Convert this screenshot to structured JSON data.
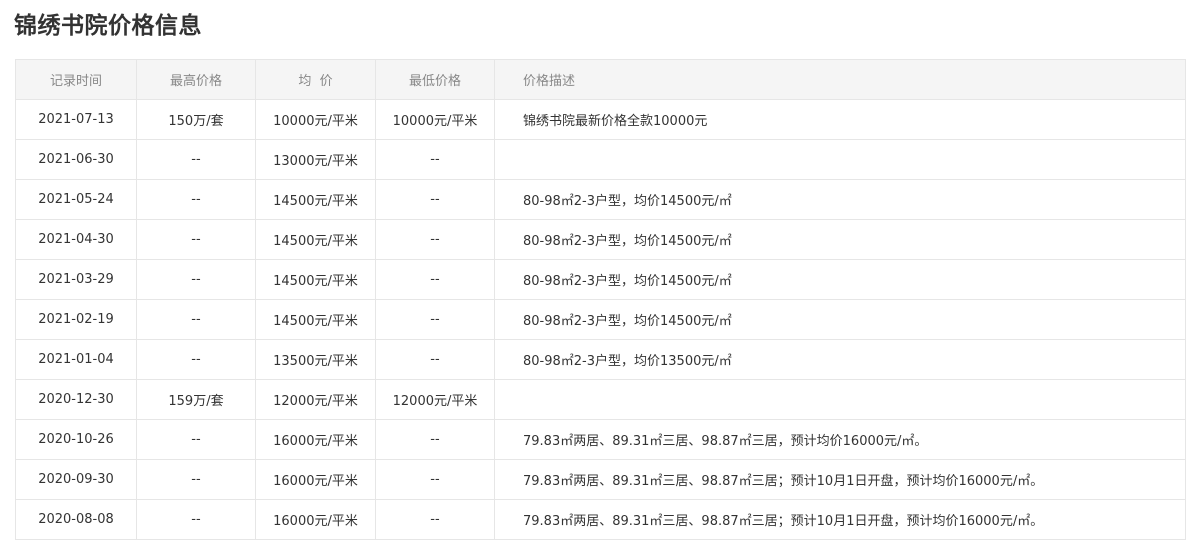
{
  "title": "锦绣书院价格信息",
  "headers": [
    "记录时间",
    "最高价格",
    "均  价",
    "最低价格",
    "价格描述"
  ],
  "rows": [
    [
      "2021-07-13",
      "150万/套",
      "10000元/平米",
      "10000元/平米",
      "锦绣书院最新价格全款10000元"
    ],
    [
      "2021-06-30",
      "--",
      "13000元/平米",
      "--",
      ""
    ],
    [
      "2021-05-24",
      "--",
      "14500元/平米",
      "--",
      "80-98㎡2-3户型，均价14500元/㎡"
    ],
    [
      "2021-04-30",
      "--",
      "14500元/平米",
      "--",
      "80-98㎡2-3户型，均价14500元/㎡"
    ],
    [
      "2021-03-29",
      "--",
      "14500元/平米",
      "--",
      "80-98㎡2-3户型，均价14500元/㎡"
    ],
    [
      "2021-02-19",
      "--",
      "14500元/平米",
      "--",
      "80-98㎡2-3户型，均价14500元/㎡"
    ],
    [
      "2021-01-04",
      "--",
      "13500元/平米",
      "--",
      "80-98㎡2-3户型，均价13500元/㎡"
    ],
    [
      "2020-12-30",
      "159万/套",
      "12000元/平米",
      "12000元/平米",
      ""
    ],
    [
      "2020-10-26",
      "--",
      "16000元/平米",
      "--",
      "79.83㎡两居、89.31㎡三居、98.87㎡三居，预计均价16000元/㎡。"
    ],
    [
      "2020-09-30",
      "--",
      "16000元/平米",
      "--",
      "79.83㎡两居、89.31㎡三居、98.87㎡三居；预计10月1日开盘，预计均价16000元/㎡。"
    ],
    [
      "2020-08-08",
      "--",
      "16000元/平米",
      "--",
      "79.83㎡两居、89.31㎡三居、98.87㎡三居；预计10月1日开盘，预计均价16000元/㎡。"
    ]
  ]
}
